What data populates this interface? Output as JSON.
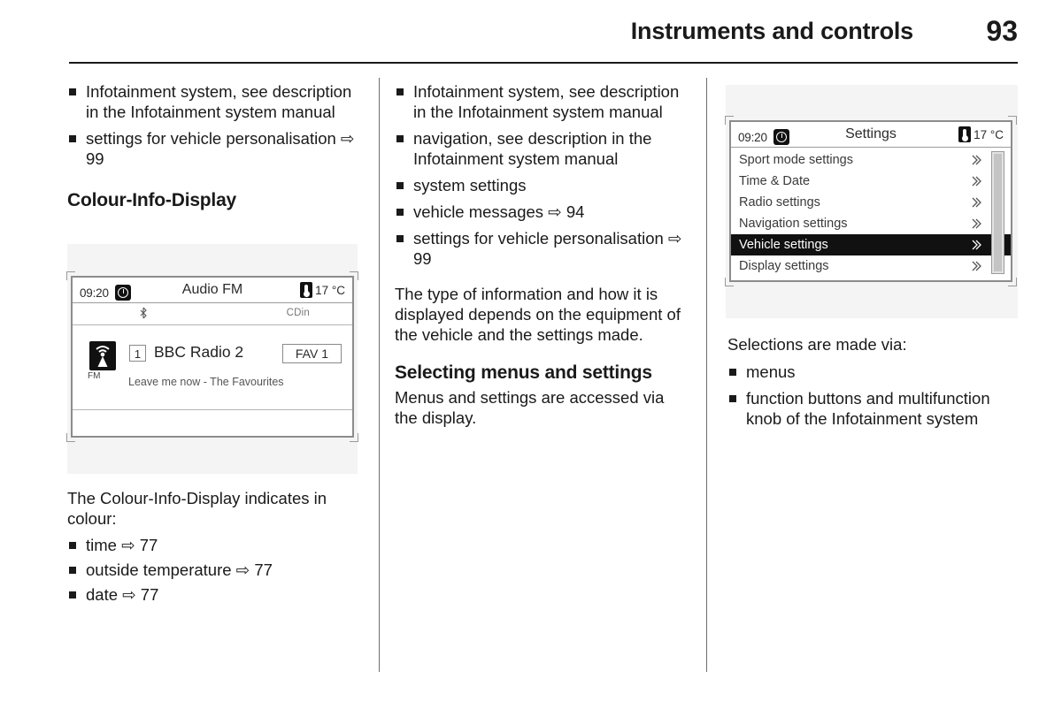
{
  "header": {
    "title": "Instruments and controls",
    "page_number": "93"
  },
  "left_column": {
    "bullets_top": [
      "Infotainment system, see description in the Infotainment system manual",
      "settings for vehicle personalisation ⇨ 99"
    ],
    "heading": "Colour-Info-Display",
    "figure": {
      "status": {
        "time": "09:20",
        "title": "Audio FM",
        "temperature": "17 °C",
        "clock_icon": "clock-icon",
        "thermometer_icon": "thermometer-icon"
      },
      "sub_bar": {
        "bluetooth_icon": "bluetooth-icon",
        "source_label": "CDin"
      },
      "body": {
        "band_label": "FM",
        "band_icon": "radio-tower-icon",
        "preset_number": "1",
        "station_name": "BBC Radio 2",
        "track_text": "Leave me now - The Favourites",
        "favourite_label": "FAV 1"
      }
    },
    "caption": "The Colour-Info-Display indicates in colour:",
    "bullets_bottom": [
      "time ⇨ 77",
      "outside temperature ⇨ 77",
      "date ⇨ 77"
    ]
  },
  "middle_column": {
    "bullets": [
      "Infotainment system, see description in the Infotainment system manual",
      "navigation, see description in the Infotainment system manual",
      "system settings",
      "vehicle messages ⇨ 94",
      "settings for vehicle personalisation ⇨ 99"
    ],
    "paragraph": "The type of information and how it is displayed depends on the equipment of the vehicle and the settings made.",
    "heading": "Selecting menus and settings",
    "paragraph2": "Menus and settings are accessed via the display."
  },
  "right_column": {
    "figure": {
      "status": {
        "time": "09:20",
        "title": "Settings",
        "temperature": "17 °C",
        "clock_icon": "clock-icon",
        "thermometer_icon": "thermometer-icon"
      },
      "menu_items": [
        {
          "label": "Sport mode settings",
          "selected": false
        },
        {
          "label": "Time & Date",
          "selected": false
        },
        {
          "label": "Radio settings",
          "selected": false
        },
        {
          "label": "Navigation settings",
          "selected": false
        },
        {
          "label": "Vehicle settings",
          "selected": true
        },
        {
          "label": "Display settings",
          "selected": false
        }
      ]
    },
    "caption": "Selections are made via:",
    "bullets": [
      "menus",
      "function buttons and multifunction knob of the Infotainment system"
    ]
  },
  "colors": {
    "text": "#1a1a1a",
    "figure_backdrop": "#f4f4f4",
    "screen_border": "#8c8c8c",
    "selected_row": "#111111",
    "divider": "#6e6e6e"
  }
}
